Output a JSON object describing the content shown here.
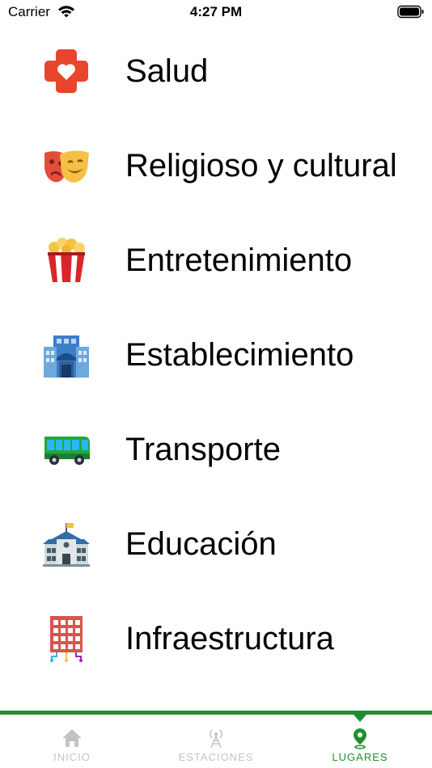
{
  "status_bar": {
    "carrier": "Carrier",
    "time": "4:27 PM"
  },
  "categories": [
    {
      "label": "Salud",
      "icon": "health-cross-heart-icon"
    },
    {
      "label": "Religioso y cultural",
      "icon": "theater-masks-icon"
    },
    {
      "label": "Entretenimiento",
      "icon": "popcorn-icon"
    },
    {
      "label": "Establecimiento",
      "icon": "building-icon"
    },
    {
      "label": "Transporte",
      "icon": "bus-icon"
    },
    {
      "label": "Educación",
      "icon": "school-icon"
    },
    {
      "label": "Infraestructura",
      "icon": "infrastructure-building-icon"
    }
  ],
  "tab_bar": {
    "tabs": [
      {
        "label": "INICIO",
        "icon": "home-icon",
        "active": false
      },
      {
        "label": "ESTACIONES",
        "icon": "antenna-tower-icon",
        "active": false
      },
      {
        "label": "LUGARES",
        "icon": "map-pin-icon",
        "active": true
      }
    ]
  },
  "colors": {
    "accent": "#1f8f2e",
    "inactive_tab": "#c4c4c4"
  }
}
